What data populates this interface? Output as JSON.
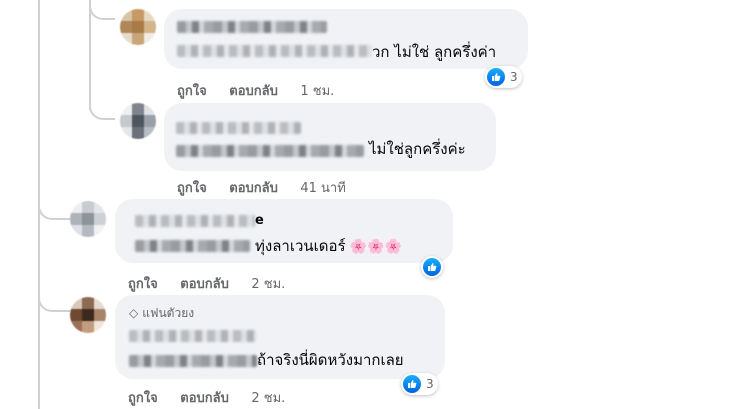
{
  "actions": {
    "like": "ถูกใจ",
    "reply": "ตอบกลับ"
  },
  "comments": [
    {
      "text": "วก ไม่ใช่ ลูกครึ่งค่า",
      "time": "1 ชม.",
      "reactions": "3"
    },
    {
      "text": "ไม่ใช่ลูกครึ่งค่ะ",
      "time": "41 นาที"
    },
    {
      "name_suffix": "e",
      "text": "ทุ่งลาเวนเดอร์",
      "emoji": "🌸🌸🌸",
      "time": "2 ชม."
    },
    {
      "badge": "แฟนตัวยง",
      "text": "ถ้าจริงนี่ผิดหวังมากเลย",
      "time": "2 ชม.",
      "reactions": "3"
    }
  ],
  "colors": {
    "bubble": "#f0f2f5",
    "like_blue": "#1877f2",
    "meta_gray": "#65676b"
  }
}
